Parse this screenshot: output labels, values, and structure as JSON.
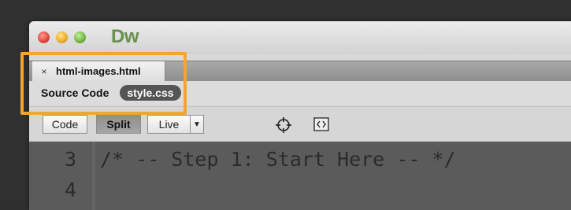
{
  "app": {
    "logo": "Dw"
  },
  "document_tab": {
    "close_glyph": "×",
    "title": "html-images.html"
  },
  "related_files": {
    "label": "Source Code",
    "file": "style.css"
  },
  "toolbar": {
    "code_label": "Code",
    "split_label": "Split",
    "live_label": "Live",
    "live_dropdown_glyph": "▼"
  },
  "editor": {
    "lines": [
      {
        "number": "3",
        "text": "/* -- Step 1: Start Here -- */"
      },
      {
        "number": "4",
        "text": ""
      }
    ]
  },
  "colors": {
    "highlight": "#f3a532",
    "logo": "#6a8f4c",
    "editor_bg": "#5b5b5b"
  }
}
